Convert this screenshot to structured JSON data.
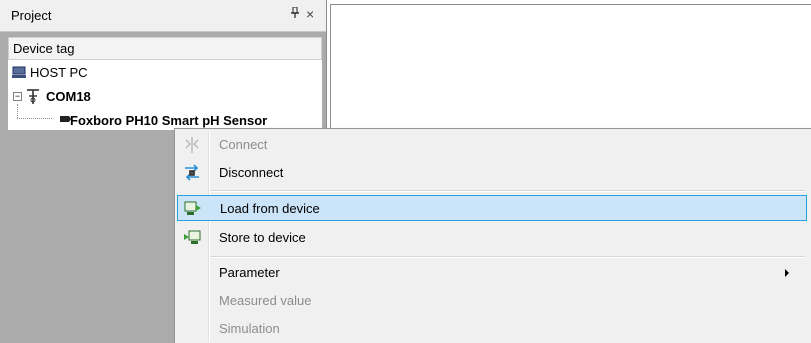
{
  "project_panel": {
    "title": "Project",
    "pin_glyph": "❁",
    "close_glyph": "×",
    "column_header": "Device tag",
    "tree": {
      "host_pc": "HOST PC",
      "com_port": "COM18",
      "device": "Foxboro PH10 Smart pH Sensor"
    }
  },
  "context_menu": {
    "items": [
      {
        "label": "Connect",
        "icon": "connect-icon",
        "enabled": false
      },
      {
        "label": "Disconnect",
        "icon": "disconnect-icon",
        "enabled": true
      },
      {
        "label": "Load from device",
        "icon": "load-from-device-icon",
        "enabled": true,
        "highlighted": true
      },
      {
        "label": "Store to device",
        "icon": "store-to-device-icon",
        "enabled": true
      },
      {
        "label": "Parameter",
        "enabled": true,
        "has_submenu": true
      },
      {
        "label": "Measured value",
        "enabled": false
      },
      {
        "label": "Simulation",
        "enabled": false
      }
    ]
  },
  "colors": {
    "highlight_bg": "#cce4f7",
    "highlight_border": "#26a0da",
    "disabled_text": "#8d8d8d",
    "panel_background": "#ababab"
  }
}
